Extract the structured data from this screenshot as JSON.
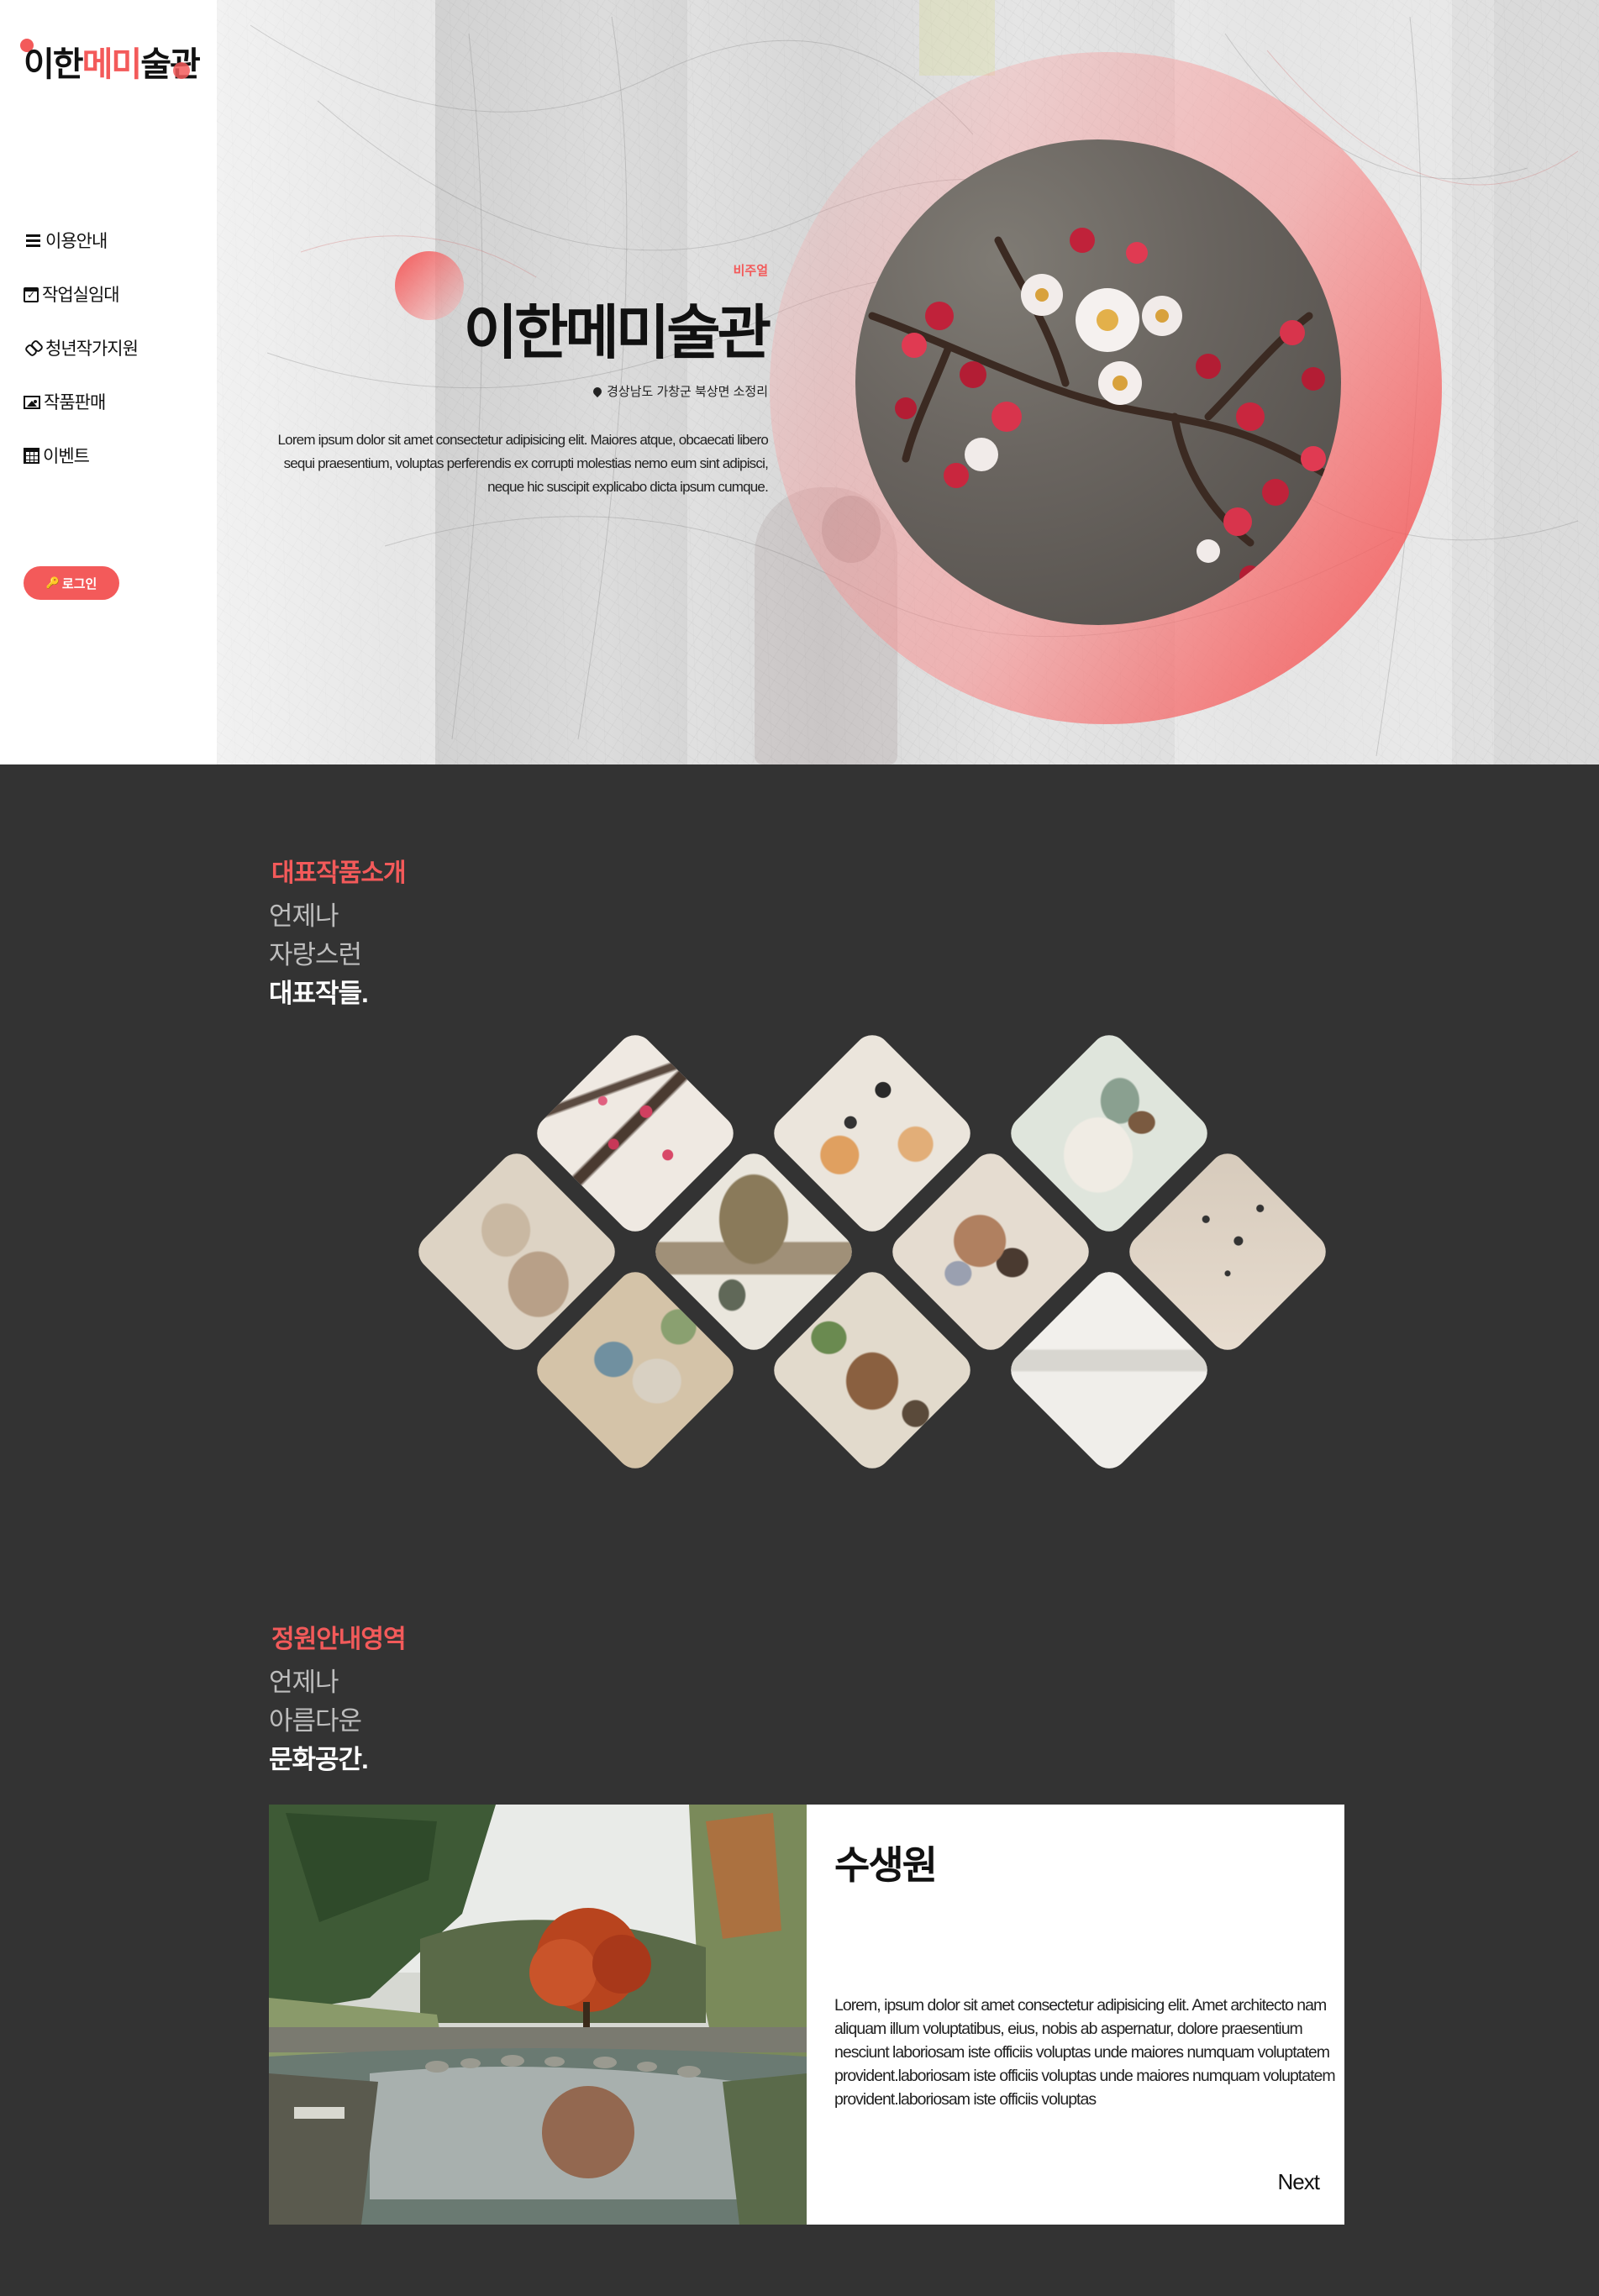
{
  "logo": {
    "part1": "이한",
    "part2": "메미",
    "part3": "술관"
  },
  "nav": [
    {
      "label": "이용안내",
      "icon": "list-icon"
    },
    {
      "label": "작업실임대",
      "icon": "calendar-check-icon"
    },
    {
      "label": "청년작가지원",
      "icon": "link-icon"
    },
    {
      "label": "작품판매",
      "icon": "image-icon"
    },
    {
      "label": "이벤트",
      "icon": "calendar-icon"
    }
  ],
  "login": {
    "label": "로그인",
    "icon": "key-icon"
  },
  "hero": {
    "subtitle": "비주얼",
    "title": "이한메미술관",
    "address": "경상남도 가창군 북상면 소정리",
    "description": "Lorem ipsum dolor sit amet consectetur adipisicing elit. Maiores atque, obcaecati libero sequi praesentium, voluptas perferendis ex corrupti molestias nemo eum sint adipisci, neque hic suscipit explicabo dicta ipsum cumque."
  },
  "works": {
    "label": "대표작품소개",
    "line1": "언제나",
    "line2": "자랑스런",
    "line3": "대표작들."
  },
  "garden": {
    "label": "정원안내영역",
    "line1": "언제나",
    "line2": "아름다운",
    "line3": "문화공간.",
    "card": {
      "title": "수생원",
      "description": "Lorem, ipsum dolor sit amet consectetur adipisicing elit. Amet architecto nam aliquam illum voluptatibus, eius, nobis ab aspernatur, dolore praesentium nesciunt laboriosam iste officiis voluptas unde maiores numquam voluptatem provident.laboriosam iste officiis voluptas unde maiores numquam voluptatem provident.laboriosam iste officiis voluptas",
      "next_label": "Next"
    }
  },
  "colors": {
    "accent": "#f35a5a",
    "dark_bg": "#333333"
  }
}
